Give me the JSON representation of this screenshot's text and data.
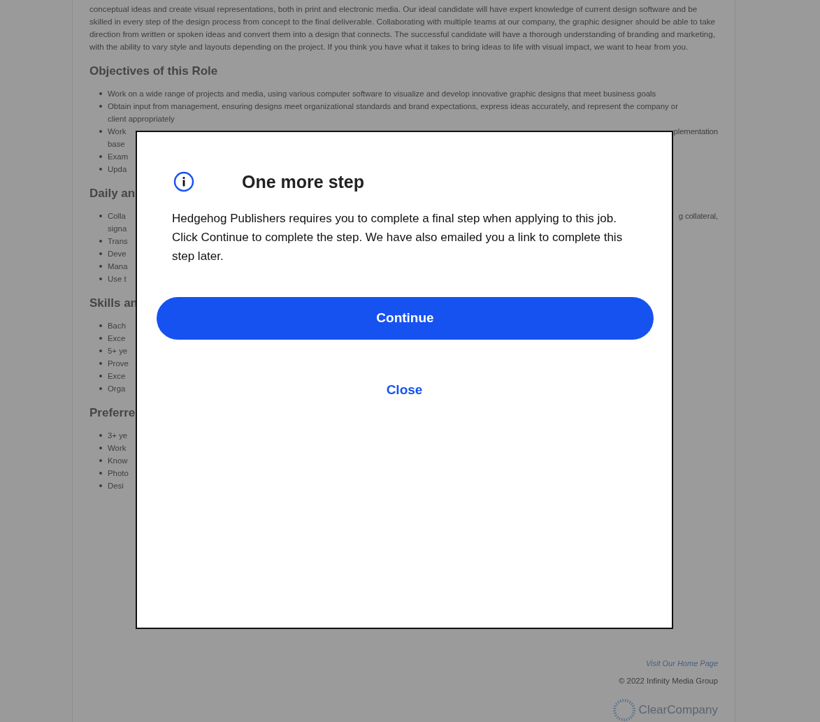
{
  "page": {
    "intro": "conceptual ideas and create visual representations, both in print and electronic media. Our ideal candidate will have expert knowledge of current design software and be skilled in every step of the design process from concept to the final deliverable. Collaborating with multiple teams at our company, the graphic designer should be able to take direction from written or spoken ideas and convert them into a design that connects. The successful candidate will have a thorough understanding of branding and marketing, with the ability to vary style and layouts depending on the project. If you think you have what it takes to bring ideas to life with visual impact, we want to hear from you.",
    "sections": [
      {
        "heading": "Objectives of this Role",
        "items": [
          {
            "lines": [
              {
                "left": "Work on a wide range of projects and media, using various computer software to visualize and develop innovative graphic designs that meet business goals"
              }
            ]
          },
          {
            "lines": [
              {
                "left": "Obtain input from management, ensuring designs meet organizational standards and brand expectations, express ideas accurately, and represent the company or"
              },
              {
                "left": "client appropriately"
              }
            ]
          },
          {
            "lines": [
              {
                "left": "Work",
                "right": "plementation"
              },
              {
                "left": "base"
              }
            ]
          },
          {
            "lines": [
              {
                "left": "Exam"
              }
            ]
          },
          {
            "lines": [
              {
                "left": "Upda"
              }
            ]
          }
        ]
      },
      {
        "heading": "Daily an",
        "items": [
          {
            "lines": [
              {
                "left": "Colla",
                "right": "g collateral,"
              },
              {
                "left": "signa"
              }
            ]
          },
          {
            "lines": [
              {
                "left": "Trans"
              }
            ]
          },
          {
            "lines": [
              {
                "left": "Deve"
              }
            ]
          },
          {
            "lines": [
              {
                "left": "Mana"
              }
            ]
          },
          {
            "lines": [
              {
                "left": "Use t"
              }
            ]
          }
        ]
      },
      {
        "heading": "Skills an",
        "items": [
          {
            "lines": [
              {
                "left": "Bach"
              }
            ]
          },
          {
            "lines": [
              {
                "left": "Exce"
              }
            ]
          },
          {
            "lines": [
              {
                "left": "5+ ye"
              }
            ]
          },
          {
            "lines": [
              {
                "left": "Prove"
              }
            ]
          },
          {
            "lines": [
              {
                "left": "Exce"
              }
            ]
          },
          {
            "lines": [
              {
                "left": "Orga"
              }
            ]
          }
        ]
      },
      {
        "heading": "Preferre",
        "items": [
          {
            "lines": [
              {
                "left": "3+ ye"
              }
            ]
          },
          {
            "lines": [
              {
                "left": "Work"
              }
            ]
          },
          {
            "lines": [
              {
                "left": "Know"
              }
            ]
          },
          {
            "lines": [
              {
                "left": "Photo"
              }
            ]
          },
          {
            "lines": [
              {
                "left": "Desi"
              }
            ]
          }
        ]
      }
    ]
  },
  "footer": {
    "link": "Visit Our Home Page",
    "copyright": "© 2022 Infinity Media Group",
    "brand": "ClearCompany"
  },
  "dialog": {
    "title": "One more step",
    "message": "Hedgehog Publishers requires you to complete a final step when applying to this job. Click Continue to complete the step. We have also emailed you a link to complete this step later.",
    "primary_button": "Continue",
    "secondary_button": "Close"
  }
}
